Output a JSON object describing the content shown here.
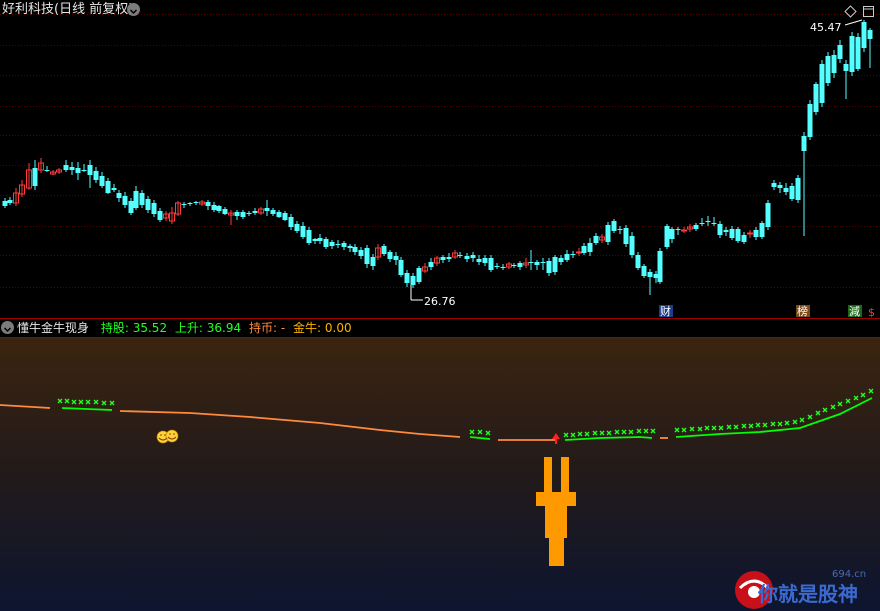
{
  "main_chart": {
    "title": "好利科技(日线 前复权)",
    "high_label": "45.47",
    "low_label": "26.76",
    "markers": [
      "财",
      "榜",
      "減",
      "$"
    ]
  },
  "indicator": {
    "name": "懂牛金牛现身",
    "hold_label": "持股:",
    "hold_value": "35.52",
    "rise_label": "上升:",
    "rise_value": "36.94",
    "coin_label": "持币:",
    "coin_value": "-",
    "gold_label": "金牛:",
    "gold_value": "0.00"
  },
  "watermark": {
    "site": "694.cn",
    "brand": "你就是股神"
  },
  "colors": {
    "up": "#ff3c3c",
    "down": "#54ffff",
    "hold": "#00ff00",
    "coin": "#ff8a3c",
    "gold": "#ffb400",
    "accent": "#ff9900"
  },
  "icons": [
    "chevron-down-icon",
    "diamond-icon",
    "window-icon",
    "smiley-icon",
    "up-arrow-icon"
  ]
}
